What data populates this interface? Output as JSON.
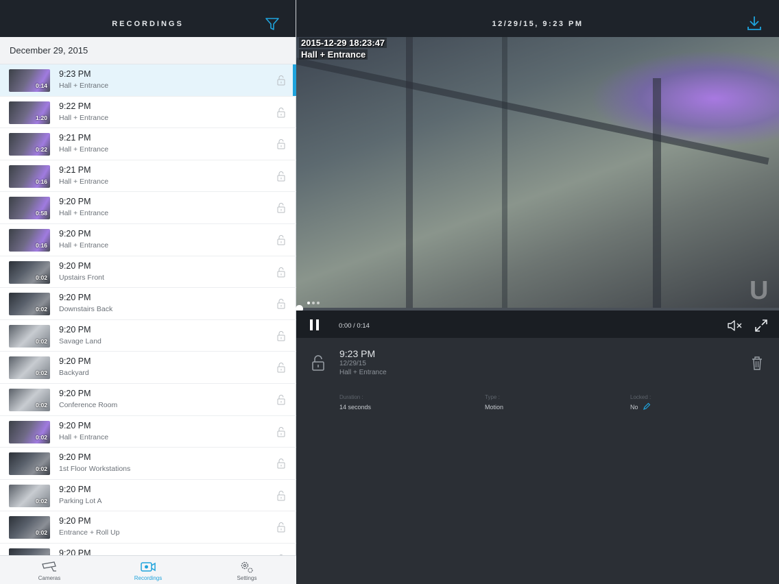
{
  "left_header": {
    "title": "RECORDINGS",
    "filter_icon": "filter-icon"
  },
  "date_header": "December 29, 2015",
  "recordings": [
    {
      "time": "9:23 PM",
      "camera": "Hall + Entrance",
      "duration": "0:14",
      "thumb": "purple",
      "selected": true
    },
    {
      "time": "9:22 PM",
      "camera": "Hall + Entrance",
      "duration": "1:20",
      "thumb": "purple"
    },
    {
      "time": "9:21 PM",
      "camera": "Hall + Entrance",
      "duration": "0:22",
      "thumb": "purple"
    },
    {
      "time": "9:21 PM",
      "camera": "Hall + Entrance",
      "duration": "0:16",
      "thumb": "purple"
    },
    {
      "time": "9:20 PM",
      "camera": "Hall + Entrance",
      "duration": "0:58",
      "thumb": "purple"
    },
    {
      "time": "9:20 PM",
      "camera": "Hall + Entrance",
      "duration": "0:16",
      "thumb": "purple"
    },
    {
      "time": "9:20 PM",
      "camera": "Upstairs Front",
      "duration": "0:02",
      "thumb": "dark"
    },
    {
      "time": "9:20 PM",
      "camera": "Downstairs Back",
      "duration": "0:02",
      "thumb": "dark"
    },
    {
      "time": "9:20 PM",
      "camera": "Savage Land",
      "duration": "0:02",
      "thumb": "bright"
    },
    {
      "time": "9:20 PM",
      "camera": "Backyard",
      "duration": "0:02",
      "thumb": "bright"
    },
    {
      "time": "9:20 PM",
      "camera": "Conference Room",
      "duration": "0:02",
      "thumb": "bright"
    },
    {
      "time": "9:20 PM",
      "camera": "Hall + Entrance",
      "duration": "0:02",
      "thumb": "purple"
    },
    {
      "time": "9:20 PM",
      "camera": "1st Floor Workstations",
      "duration": "0:02",
      "thumb": "dark"
    },
    {
      "time": "9:20 PM",
      "camera": "Parking Lot A",
      "duration": "0:02",
      "thumb": "bright"
    },
    {
      "time": "9:20 PM",
      "camera": "Entrance + Roll Up",
      "duration": "0:02",
      "thumb": "dark"
    },
    {
      "time": "9:20 PM",
      "camera": "",
      "duration": "",
      "thumb": "dark"
    }
  ],
  "tabbar": {
    "cameras": "Cameras",
    "recordings": "Recordings",
    "settings": "Settings"
  },
  "right_header": {
    "title": "12/29/15, 9:23 PM",
    "download_icon": "download-icon"
  },
  "video": {
    "overlay_timestamp": "2015-12-29 18:23:47",
    "overlay_camera": "Hall + Entrance",
    "page_count": 3,
    "active_page": 0
  },
  "player": {
    "time_readout": "0:00 / 0:14",
    "progress": 0.0
  },
  "details": {
    "time": "9:23 PM",
    "date": "12/29/15",
    "camera": "Hall + Entrance",
    "duration_label": "Duration :",
    "duration_value": "14 seconds",
    "type_label": "Type :",
    "type_value": "Motion",
    "locked_label": "Locked :",
    "locked_value": "No"
  },
  "colors": {
    "accent": "#1fa3dc",
    "header_bg": "#1e232a",
    "panel_bg": "#2b2f35"
  }
}
